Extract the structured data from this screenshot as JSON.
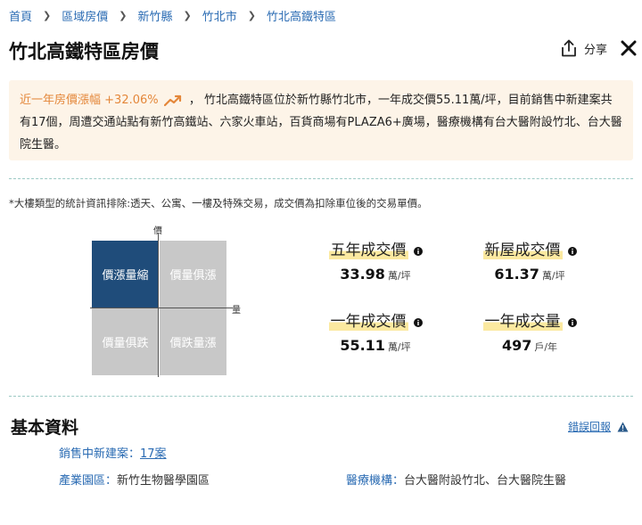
{
  "breadcrumb": [
    "首頁",
    "區域房價",
    "新竹縣",
    "竹北市",
    "竹北高鐵特區"
  ],
  "page": {
    "title": "竹北高鐵特區房價",
    "share_label": "分享",
    "close_icon": "close-icon",
    "share_icon": "share-icon"
  },
  "summary": {
    "up_label": "近一年房價漲幅",
    "up_value": "+32.06%",
    "trend_icon": "trending-up-icon",
    "text": "， 竹北高鐵特區位於新竹縣竹北市，一年成交價55.11萬/坪，目前銷售中新建案共有17個，周遭交通站點有新竹高鐵站、六家火車站，百貨商場有PLAZA6+廣場，醫療機構有台大醫附設竹北、台大醫院生醫。"
  },
  "note": "*大樓類型的統計資訊排除:透天、公寓、一樓及特殊交易，成交價為扣除車位後的交易單價。",
  "quadrant": {
    "price_axis": "價",
    "volume_axis": "量",
    "top_left": "價漲量縮",
    "top_right": "價量俱漲",
    "bottom_left": "價量俱跌",
    "bottom_right": "價跌量漲",
    "active": "top_left"
  },
  "stats": {
    "five_year": {
      "title": "五年成交價",
      "value": "33.98",
      "unit": "萬/坪"
    },
    "new_house": {
      "title": "新屋成交價",
      "value": "61.37",
      "unit": "萬/坪"
    },
    "one_year": {
      "title": "一年成交價",
      "value": "55.11",
      "unit": "萬/坪"
    },
    "one_year_volume": {
      "title": "一年成交量",
      "value": "497",
      "unit": "戶/年"
    }
  },
  "basic": {
    "title": "基本資料",
    "report_label": "錯誤回報",
    "selling_key": "銷售中新建案：",
    "selling_value": "17案",
    "industry_key": "產業園區：",
    "industry_value": "新竹生物醫學園區",
    "medical_key": "醫療機構：",
    "medical_value": "台大醫附設竹北、台大醫院生醫"
  },
  "colors": {
    "link": "#2a6bb3",
    "accent": "#e4873a",
    "summary_bg": "#fdf4e8",
    "quad_active": "#1f4c7a",
    "quad_inactive": "#c8c8c8",
    "highlight": "#fbe9a0"
  }
}
